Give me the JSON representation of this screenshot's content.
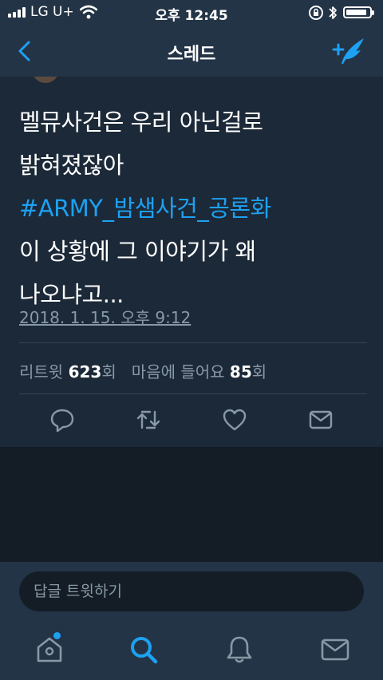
{
  "status_bar": {
    "carrier": "LG U+",
    "time": "오후 12:45",
    "battery_level": 0.9
  },
  "nav": {
    "title": "스레드"
  },
  "tweet": {
    "lines": [
      "멜뮤사건은 우리 아닌걸로",
      "밝혀졌잖아"
    ],
    "hashtag": "#ARMY_밤샘사건_공론화",
    "lines2": [
      "이 상황에 그 이야기가 왜",
      "나오냐고..."
    ],
    "timestamp": "2018. 1. 15. 오후 9:12",
    "retweet_label": "리트윗",
    "retweet_count": "623",
    "retweet_unit": "회",
    "like_label": "마음에 들어요",
    "like_count": "85",
    "like_unit": "회"
  },
  "reply": {
    "placeholder": "답글 트윗하기"
  },
  "tabs": [
    "home-icon",
    "search-icon",
    "notifications-icon",
    "messages-icon"
  ],
  "colors": {
    "accent": "#1da1f2",
    "background": "#141d26",
    "card": "#1c2938",
    "bar": "#243447",
    "muted": "#8899a6"
  }
}
